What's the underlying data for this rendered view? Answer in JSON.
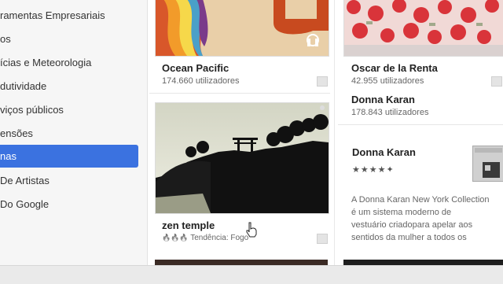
{
  "sidebar": {
    "items": [
      {
        "label": "ramentas Empresariais"
      },
      {
        "label": "os"
      },
      {
        "label": "ícias e Meteorologia"
      },
      {
        "label": "dutividade"
      },
      {
        "label": "viços públicos"
      },
      {
        "label": "ensões"
      },
      {
        "label": "nas"
      },
      {
        "label": "De Artistas"
      },
      {
        "label": "Do Google"
      }
    ],
    "active_index": 6
  },
  "cards": {
    "ocean": {
      "title": "Ocean Pacific",
      "users": "174.660 utilizadores"
    },
    "oscar": {
      "title": "Oscar de la Renta",
      "users": "42.955 utilizadores"
    },
    "donna_list": {
      "title": "Donna Karan",
      "users": "178.843 utilizadores"
    },
    "zen": {
      "title": "zen temple",
      "trend_icons": "🔥🔥🔥",
      "trend": "Tendência: Fogo"
    },
    "donna_detail": {
      "title": "Donna Karan",
      "stars": "★★★★",
      "star_half": "✦",
      "description": [
        "A Donna Karan New York Collection",
        "é um sistema moderno de",
        "vestuário criadopara apelar aos",
        "sentidos da mulher a todos os"
      ]
    }
  },
  "colors": {
    "accent": "#3b72e0",
    "sidebar_bg": "#f6f6f6"
  }
}
